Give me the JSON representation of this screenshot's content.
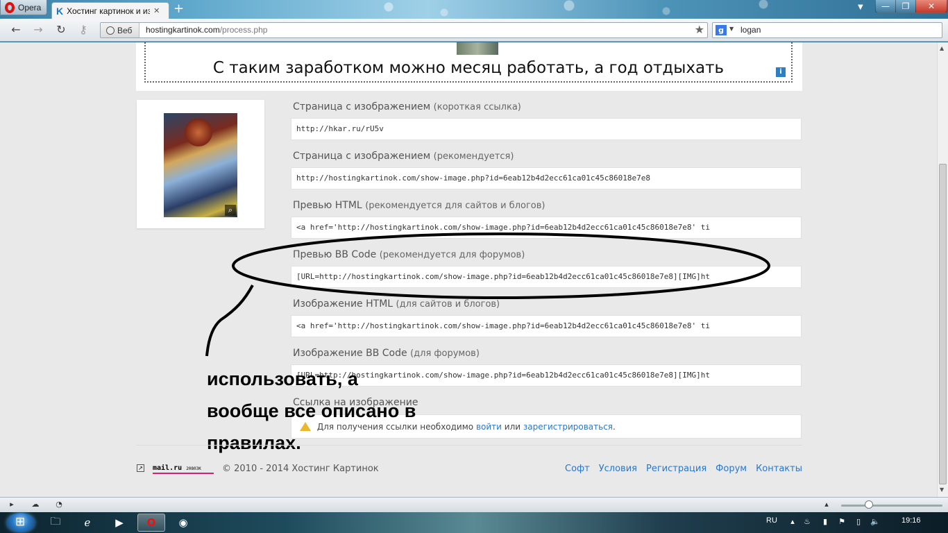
{
  "browser": {
    "menu_label": "Opera",
    "tab_title": "Хостинг картинок и из...",
    "tab_favicon": "K",
    "address_badge": "Веб",
    "url_host": "hostingkartinok.com",
    "url_path": "/process.php",
    "search_engine_icon": "g",
    "search_query": "logan"
  },
  "banner": {
    "text": "С таким заработком можно месяц работать, а год отдыхать",
    "info_icon": "i"
  },
  "fields": [
    {
      "label": "Страница с изображением",
      "sub": "(короткая ссылка)",
      "value": "http://hkar.ru/rU5v"
    },
    {
      "label": "Страница с изображением",
      "sub": "(рекомендуется)",
      "value": "http://hostingkartinok.com/show-image.php?id=6eab12b4d2ecc61ca01c45c86018e7e8"
    },
    {
      "label": "Превью HTML",
      "sub": "(рекомендуется для сайтов и блогов)",
      "value": "<a href='http://hostingkartinok.com/show-image.php?id=6eab12b4d2ecc61ca01c45c86018e7e8' ti"
    },
    {
      "label": "Превью BB Code",
      "sub": "(рекомендуется для форумов)",
      "value": "[URL=http://hostingkartinok.com/show-image.php?id=6eab12b4d2ecc61ca01c45c86018e7e8][IMG]ht"
    },
    {
      "label": "Изображение HTML",
      "sub": "(для сайтов и блогов)",
      "value": "<a href='http://hostingkartinok.com/show-image.php?id=6eab12b4d2ecc61ca01c45c86018e7e8' ti"
    },
    {
      "label": "Изображение BB Code",
      "sub": "(для форумов)",
      "value": "[URL=http://hostingkartinok.com/show-image.php?id=6eab12b4d2ecc61ca01c45c86018e7e8][IMG]ht"
    },
    {
      "label": "Ссылка на изображение",
      "sub": ""
    }
  ],
  "notice": {
    "prefix": "Для получения ссылки необходимо",
    "login": "войти",
    "middle": "или",
    "register": "зарегистрироваться",
    "suffix": "."
  },
  "annotation": {
    "line1": "использовать, а",
    "line2": "вообще все описано в",
    "line3": "правилах."
  },
  "footer": {
    "counter_name": "mail.ru",
    "counter_value": "20803K",
    "copyright": "© 2010 - 2014 Хостинг Картинок",
    "links": [
      "Софт",
      "Условия",
      "Регистрация",
      "Форум",
      "Контакты"
    ]
  },
  "taskbar": {
    "language": "RU",
    "clock": "19:16"
  },
  "colors": {
    "link": "#2a77c9",
    "annotation_ink": "#000000",
    "counter_underline": "#d0207a"
  }
}
